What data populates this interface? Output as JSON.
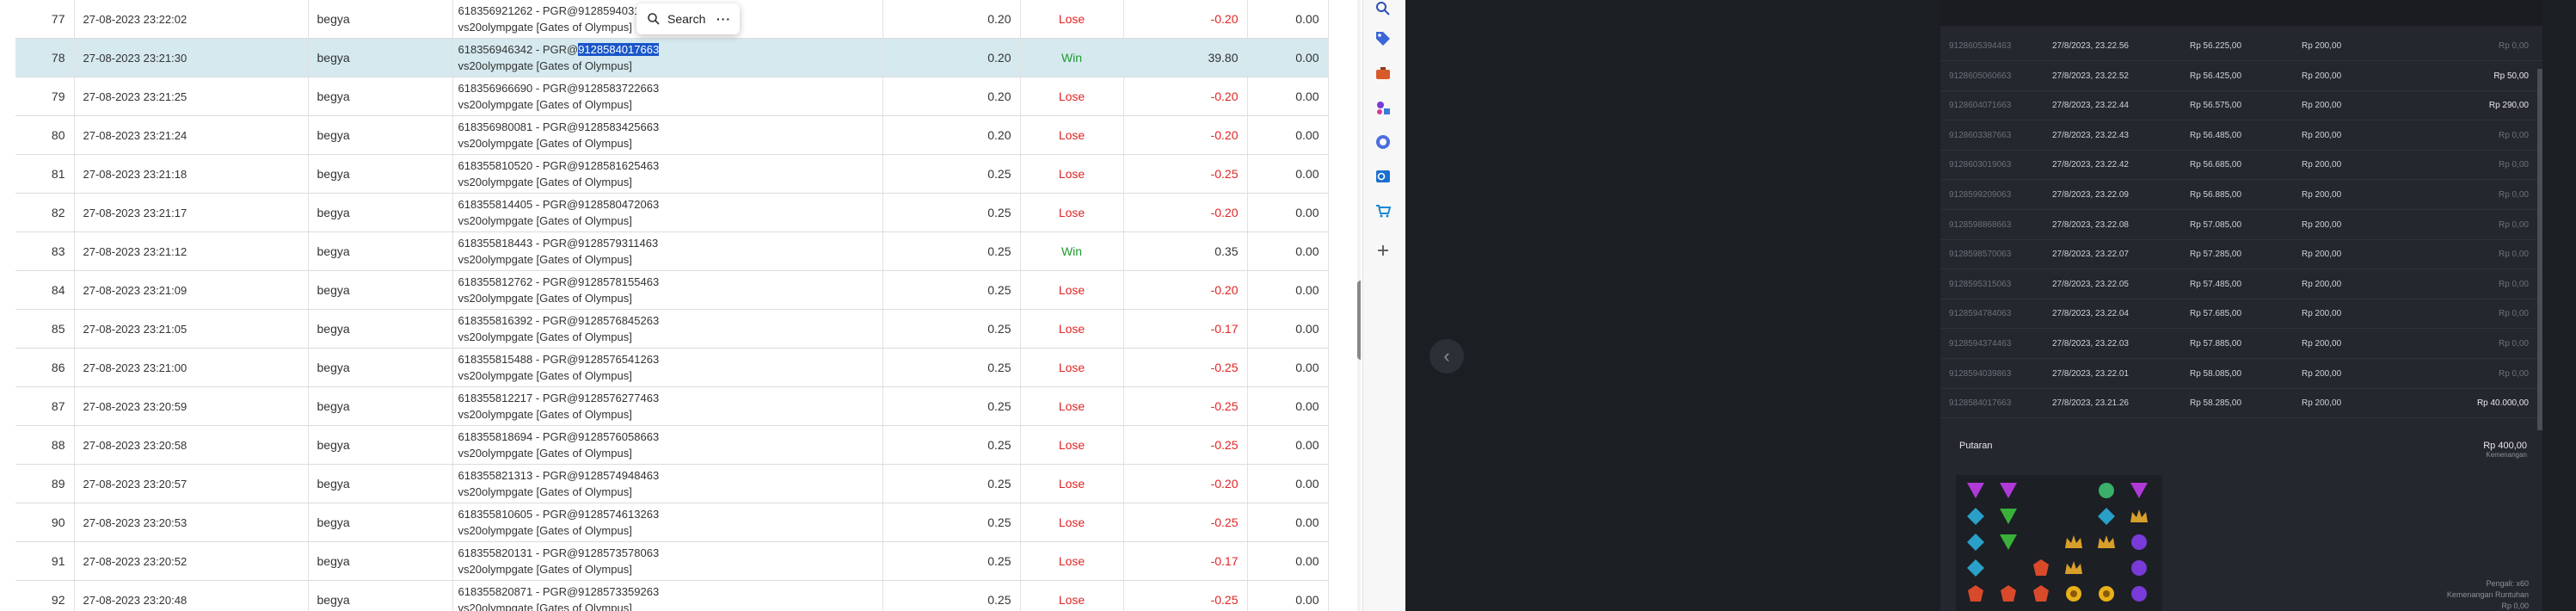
{
  "context_popup": {
    "search_label": "Search",
    "more_label": "···"
  },
  "table": {
    "rows": [
      {
        "no": "77",
        "datetime": "27-08-2023 23:22:02",
        "user": "begya",
        "detail1": "618356921262 - PGR@9128594031663",
        "detail2": "vs20olympgate [Gates of Olympus]",
        "bet": "0.20",
        "result": "Lose",
        "winlose": "-0.20",
        "jp": "0.00",
        "selected": false
      },
      {
        "no": "78",
        "datetime": "27-08-2023 23:21:30",
        "user": "begya",
        "detail1_prefix": "618356946342 - PGR@",
        "detail1_highlight": "9128584017663",
        "detail2": "vs20olympgate [Gates of Olympus]",
        "bet": "0.20",
        "result": "Win",
        "winlose": "39.80",
        "jp": "0.00",
        "selected": true
      },
      {
        "no": "79",
        "datetime": "27-08-2023 23:21:25",
        "user": "begya",
        "detail1": "618356966690 - PGR@9128583722663",
        "detail2": "vs20olympgate [Gates of Olympus]",
        "bet": "0.20",
        "result": "Lose",
        "winlose": "-0.20",
        "jp": "0.00",
        "selected": false
      },
      {
        "no": "80",
        "datetime": "27-08-2023 23:21:24",
        "user": "begya",
        "detail1": "618356980081 - PGR@9128583425663",
        "detail2": "vs20olympgate [Gates of Olympus]",
        "bet": "0.20",
        "result": "Lose",
        "winlose": "-0.20",
        "jp": "0.00",
        "selected": false
      },
      {
        "no": "81",
        "datetime": "27-08-2023 23:21:18",
        "user": "begya",
        "detail1": "618355810520 - PGR@9128581625463",
        "detail2": "vs20olympgate [Gates of Olympus]",
        "bet": "0.25",
        "result": "Lose",
        "winlose": "-0.25",
        "jp": "0.00",
        "selected": false
      },
      {
        "no": "82",
        "datetime": "27-08-2023 23:21:17",
        "user": "begya",
        "detail1": "618355814405 - PGR@9128580472063",
        "detail2": "vs20olympgate [Gates of Olympus]",
        "bet": "0.25",
        "result": "Lose",
        "winlose": "-0.20",
        "jp": "0.00",
        "selected": false
      },
      {
        "no": "83",
        "datetime": "27-08-2023 23:21:12",
        "user": "begya",
        "detail1": "618355818443 - PGR@9128579311463",
        "detail2": "vs20olympgate [Gates of Olympus]",
        "bet": "0.25",
        "result": "Win",
        "winlose": "0.35",
        "jp": "0.00",
        "selected": false
      },
      {
        "no": "84",
        "datetime": "27-08-2023 23:21:09",
        "user": "begya",
        "detail1": "618355812762 - PGR@9128578155463",
        "detail2": "vs20olympgate [Gates of Olympus]",
        "bet": "0.25",
        "result": "Lose",
        "winlose": "-0.20",
        "jp": "0.00",
        "selected": false
      },
      {
        "no": "85",
        "datetime": "27-08-2023 23:21:05",
        "user": "begya",
        "detail1": "618355816392 - PGR@9128576845263",
        "detail2": "vs20olympgate [Gates of Olympus]",
        "bet": "0.25",
        "result": "Lose",
        "winlose": "-0.17",
        "jp": "0.00",
        "selected": false
      },
      {
        "no": "86",
        "datetime": "27-08-2023 23:21:00",
        "user": "begya",
        "detail1": "618355815488 - PGR@9128576541263",
        "detail2": "vs20olympgate [Gates of Olympus]",
        "bet": "0.25",
        "result": "Lose",
        "winlose": "-0.25",
        "jp": "0.00",
        "selected": false
      },
      {
        "no": "87",
        "datetime": "27-08-2023 23:20:59",
        "user": "begya",
        "detail1": "618355812217 - PGR@9128576277463",
        "detail2": "vs20olympgate [Gates of Olympus]",
        "bet": "0.25",
        "result": "Lose",
        "winlose": "-0.25",
        "jp": "0.00",
        "selected": false
      },
      {
        "no": "88",
        "datetime": "27-08-2023 23:20:58",
        "user": "begya",
        "detail1": "618355818694 - PGR@9128576058663",
        "detail2": "vs20olympgate [Gates of Olympus]",
        "bet": "0.25",
        "result": "Lose",
        "winlose": "-0.25",
        "jp": "0.00",
        "selected": false
      },
      {
        "no": "89",
        "datetime": "27-08-2023 23:20:57",
        "user": "begya",
        "detail1": "618355821313 - PGR@9128574948463",
        "detail2": "vs20olympgate [Gates of Olympus]",
        "bet": "0.25",
        "result": "Lose",
        "winlose": "-0.20",
        "jp": "0.00",
        "selected": false
      },
      {
        "no": "90",
        "datetime": "27-08-2023 23:20:53",
        "user": "begya",
        "detail1": "618355810605 - PGR@9128574613263",
        "detail2": "vs20olympgate [Gates of Olympus]",
        "bet": "0.25",
        "result": "Lose",
        "winlose": "-0.25",
        "jp": "0.00",
        "selected": false
      },
      {
        "no": "91",
        "datetime": "27-08-2023 23:20:52",
        "user": "begya",
        "detail1": "618355820131 - PGR@9128573578063",
        "detail2": "vs20olympgate [Gates of Olympus]",
        "bet": "0.25",
        "result": "Lose",
        "winlose": "-0.17",
        "jp": "0.00",
        "selected": false
      },
      {
        "no": "92",
        "datetime": "27-08-2023 23:20:48",
        "user": "begya",
        "detail1": "618355820871 - PGR@9128573359263",
        "detail2": "vs20olympgate [Gates of Olympus]",
        "bet": "0.25",
        "result": "Lose",
        "winlose": "-0.25",
        "jp": "0.00",
        "selected": false
      }
    ]
  },
  "history_panel": {
    "rows": [
      {
        "id": "9128605394463",
        "date": "27/8/2023, 23.22.56",
        "balance": "Rp 56.225,00",
        "bet": "Rp 200,00",
        "win": "Rp 0,00",
        "won": false
      },
      {
        "id": "9128605060663",
        "date": "27/8/2023, 23.22.52",
        "balance": "Rp 56.425,00",
        "bet": "Rp 200,00",
        "win": "Rp 50,00",
        "won": true
      },
      {
        "id": "9128604071663",
        "date": "27/8/2023, 23.22.44",
        "balance": "Rp 56.575,00",
        "bet": "Rp 200,00",
        "win": "Rp 290,00",
        "won": true
      },
      {
        "id": "9128603387663",
        "date": "27/8/2023, 23.22.43",
        "balance": "Rp 56.485,00",
        "bet": "Rp 200,00",
        "win": "Rp 0,00",
        "won": false
      },
      {
        "id": "9128603019063",
        "date": "27/8/2023, 23.22.42",
        "balance": "Rp 56.685,00",
        "bet": "Rp 200,00",
        "win": "Rp 0,00",
        "won": false
      },
      {
        "id": "9128599209063",
        "date": "27/8/2023, 23.22.09",
        "balance": "Rp 56.885,00",
        "bet": "Rp 200,00",
        "win": "Rp 0,00",
        "won": false
      },
      {
        "id": "9128598868663",
        "date": "27/8/2023, 23.22.08",
        "balance": "Rp 57.085,00",
        "bet": "Rp 200,00",
        "win": "Rp 0,00",
        "won": false
      },
      {
        "id": "9128598570063",
        "date": "27/8/2023, 23.22.07",
        "balance": "Rp 57.285,00",
        "bet": "Rp 200,00",
        "win": "Rp 0,00",
        "won": false
      },
      {
        "id": "9128595315063",
        "date": "27/8/2023, 23.22.05",
        "balance": "Rp 57.485,00",
        "bet": "Rp 200,00",
        "win": "Rp 0,00",
        "won": false
      },
      {
        "id": "9128594784063",
        "date": "27/8/2023, 23.22.04",
        "balance": "Rp 57.685,00",
        "bet": "Rp 200,00",
        "win": "Rp 0,00",
        "won": false
      },
      {
        "id": "9128594374463",
        "date": "27/8/2023, 23.22.03",
        "balance": "Rp 57.885,00",
        "bet": "Rp 200,00",
        "win": "Rp 0,00",
        "won": false
      },
      {
        "id": "9128594039863",
        "date": "27/8/2023, 23.22.01",
        "balance": "Rp 58.085,00",
        "bet": "Rp 200,00",
        "win": "Rp 0,00",
        "won": false
      },
      {
        "id": "9128584017663",
        "date": "27/8/2023, 23.21.26",
        "balance": "Rp 58.285,00",
        "bet": "Rp 200,00",
        "win": "Rp 40.000,00",
        "won": true
      }
    ],
    "round_label": "Putaran",
    "round_total": "Rp 400,00",
    "round_total_sub": "Kemenangan",
    "footer_line1": "Pengali: x60",
    "footer_line2": "Kemenangan Runtuhan",
    "footer_line3": "Rp 0,00"
  },
  "colors": {
    "lose": "#e02424",
    "win": "#1e9a2c",
    "selected_row": "#d5e9ef",
    "highlight": "#1a56c8"
  }
}
